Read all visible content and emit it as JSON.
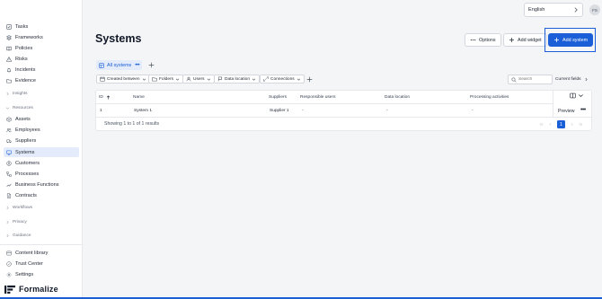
{
  "sidebar": {
    "top_items": [
      {
        "label": "Tasks",
        "icon": "check-square-icon"
      },
      {
        "label": "Frameworks",
        "icon": "layers-icon"
      },
      {
        "label": "Policies",
        "icon": "book-icon"
      },
      {
        "label": "Risks",
        "icon": "warning-icon"
      },
      {
        "label": "Incidents",
        "icon": "bell-icon"
      },
      {
        "label": "Evidence",
        "icon": "folder-icon"
      }
    ],
    "groups": {
      "insights": "Insights",
      "resources": "Resources",
      "workflows": "Workflows",
      "privacy": "Privacy",
      "guidance": "Guidance"
    },
    "resource_items": [
      {
        "label": "Assets",
        "icon": "box-icon"
      },
      {
        "label": "Employees",
        "icon": "users-icon"
      },
      {
        "label": "Suppliers",
        "icon": "truck-icon"
      },
      {
        "label": "Systems",
        "icon": "monitor-icon",
        "active": true
      },
      {
        "label": "Customers",
        "icon": "user-circle-icon"
      },
      {
        "label": "Processes",
        "icon": "flow-icon"
      },
      {
        "label": "Business Functions",
        "icon": "line-chart-icon"
      },
      {
        "label": "Contracts",
        "icon": "file-icon"
      }
    ],
    "bottom_items": [
      {
        "label": "Content library",
        "icon": "library-icon"
      },
      {
        "label": "Trust Center",
        "icon": "shield-icon"
      },
      {
        "label": "Settings",
        "icon": "gear-icon"
      }
    ],
    "brand": "Formalize"
  },
  "header": {
    "language": "English",
    "avatar_initials": "FS"
  },
  "page": {
    "title": "Systems",
    "options_label": "Options",
    "add_widget_label": "Add widget",
    "add_system_label": "Add system"
  },
  "views": {
    "tab_label": "All systems"
  },
  "filters": [
    {
      "label": "Created between",
      "icon": "calendar-icon"
    },
    {
      "label": "Folders",
      "icon": "folder-icon"
    },
    {
      "label": "Users",
      "icon": "user-icon"
    },
    {
      "label": "Data location",
      "icon": "flag-icon"
    },
    {
      "label": "Connections",
      "icon": "link-icon"
    }
  ],
  "search": {
    "placeholder": "Search",
    "current_fields_label": "Current fields"
  },
  "table": {
    "columns": [
      "ID",
      "Name",
      "Suppliers",
      "Responsible users",
      "Data location",
      "Processing activities"
    ],
    "rows": [
      {
        "id": "1",
        "name": "System 1",
        "suppliers": "Supplier 1",
        "responsible_users": "-",
        "data_location": "-",
        "processing_activities": "-"
      }
    ],
    "preview_label": "Preview",
    "showing_text": "Showing 1 to 1 of 1 results",
    "current_page": "1"
  },
  "colors": {
    "accent": "#1a5fd8",
    "active_bg": "#e4ecfb",
    "page_bg": "#f4f5f7"
  }
}
